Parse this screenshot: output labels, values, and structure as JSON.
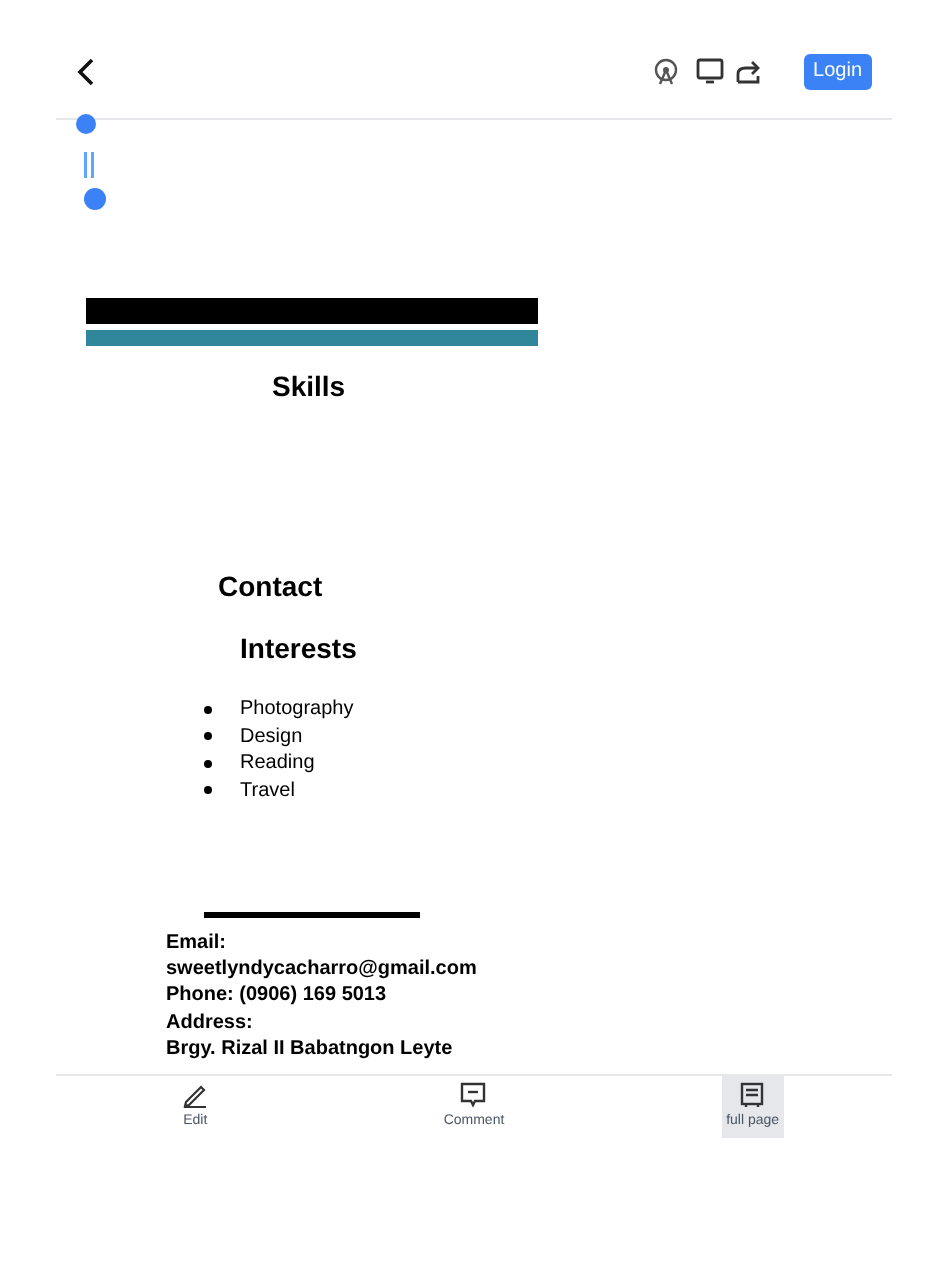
{
  "header": {
    "login_button": "Login"
  },
  "document": {
    "headings": [
      {
        "text": "Skills",
        "kind": "section"
      },
      {
        "text": "Contact",
        "kind": "section"
      },
      {
        "text": "Interests",
        "kind": "section"
      }
    ],
    "interests": [
      "Photography",
      "Design",
      "Reading",
      "Travel"
    ],
    "contact_lines": [
      "Email:",
      "sweetlyndycacharro@gmail.com",
      "Phone: (0906) 169 5013",
      "Address:",
      "Brgy. Rizal II Babatngon Leyte"
    ]
  },
  "toolbar": [
    {
      "label": "Edit",
      "kind": "edit",
      "selected": false
    },
    {
      "label": "Comment",
      "kind": "comment",
      "selected": false
    },
    {
      "label": "full page",
      "kind": "fullpage",
      "selected": true
    }
  ]
}
